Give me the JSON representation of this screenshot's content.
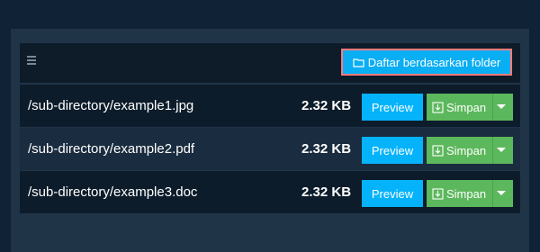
{
  "toolbar": {
    "menu_icon": "menu-icon",
    "folder_button": {
      "label": "Daftar berdasarkan folder",
      "icon": "folder-icon",
      "color": "#0aaef3",
      "highlight_border": "#ff7b7b"
    }
  },
  "files": [
    {
      "path": "/sub-directory/example1.jpg",
      "size": "2.32 KB",
      "preview_label": "Preview",
      "save_label": "Simpan"
    },
    {
      "path": "/sub-directory/example2.pdf",
      "size": "2.32 KB",
      "preview_label": "Preview",
      "save_label": "Simpan"
    },
    {
      "path": "/sub-directory/example3.doc",
      "size": "2.32 KB",
      "preview_label": "Preview",
      "save_label": "Simpan"
    }
  ],
  "colors": {
    "background": "#0f2236",
    "panel": "#203448",
    "preview_button": "#05b3fb",
    "save_button": "#5cb85c"
  }
}
